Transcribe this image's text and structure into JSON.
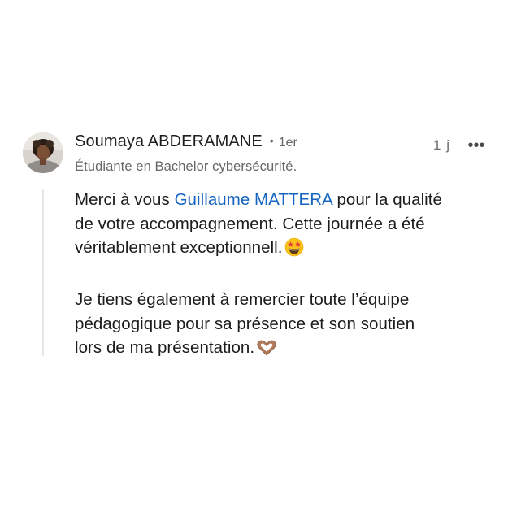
{
  "comment": {
    "author": {
      "name": "Soumaya ABDERAMANE",
      "separator": "•",
      "degree": "1er",
      "headline": "Étudiante en Bachelor cybersécurité.",
      "avatar": "profile-photo"
    },
    "time_ago": "1 j",
    "more_icon": "•••",
    "paragraph1": {
      "before": "Merci à vous ",
      "mention": "Guillaume MATTERA",
      "after_line1": " pour la qualité",
      "rest": "de votre accompagnement. Cette journée a été\nvéritablement exceptionnell."
    },
    "paragraph2": "Je tiens également à remercier toute l’équipe\npédagogique pour sa présence et son soutien\nlors de ma présentation.",
    "emojis": {
      "first": "star-struck-emoji",
      "second": "heart-hands-emoji"
    },
    "colors": {
      "mention": "#1565c0",
      "secondary_text": "#666666",
      "thread_line": "#e6e6e6"
    }
  }
}
